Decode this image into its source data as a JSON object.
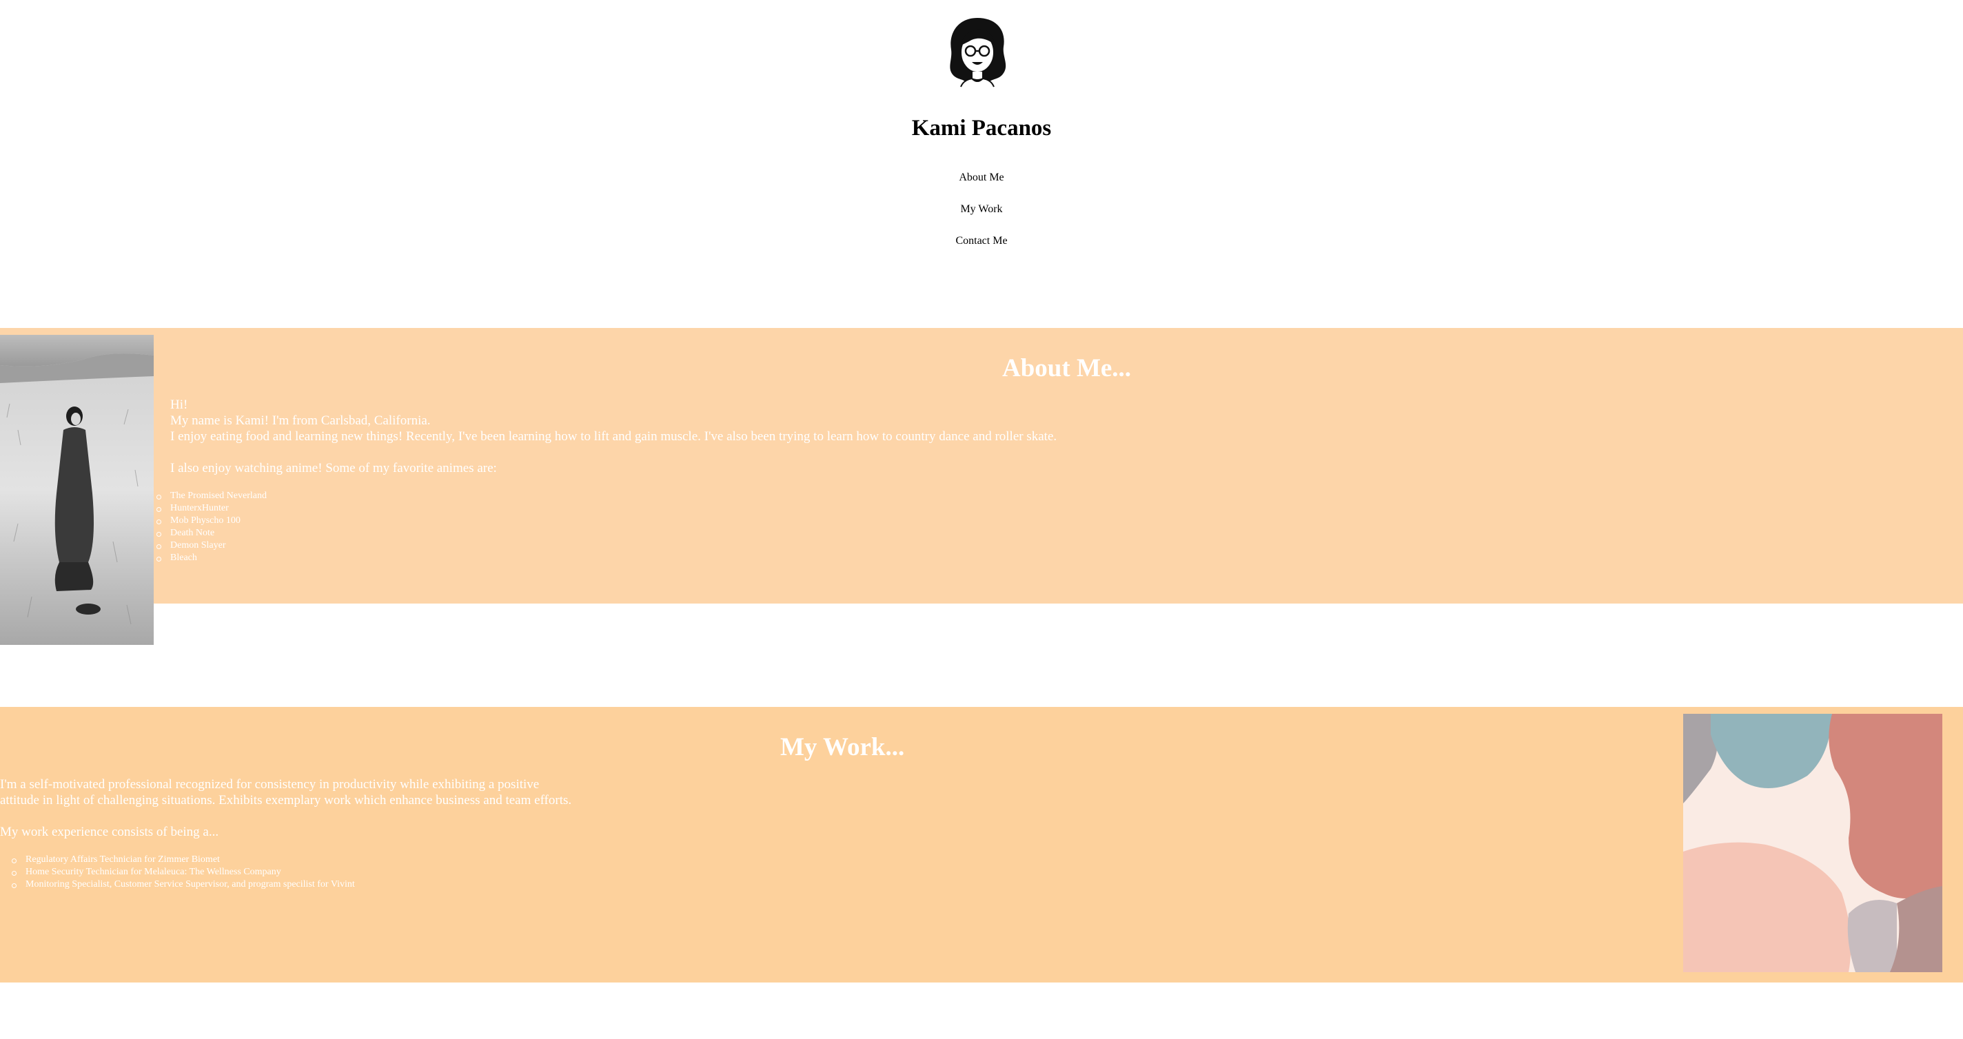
{
  "header": {
    "avatar_icon": "cartoon-woman-with-glasses-portrait",
    "title": "Kami Pacanos"
  },
  "nav": {
    "items": [
      "About Me",
      "My Work",
      "Contact Me"
    ]
  },
  "about": {
    "heading": "About Me...",
    "lines": [
      "Hi!",
      "My name is Kami! I'm from Carlsbad, California.",
      "I enjoy eating food and learning new things! Recently, I've been learning how to lift and gain muscle. I've also been trying to learn how to country dance and roller skate."
    ],
    "anime_intro": "I also enjoy watching anime! Some of my favorite animes are:",
    "animes": [
      "The Promised Neverland",
      "HunterxHunter",
      "Mob Physcho 100",
      "Death Note",
      "Demon Slayer",
      "Bleach"
    ],
    "photo": "black-and-white-photo-woman-in-field"
  },
  "work": {
    "heading": "My Work...",
    "paragraph_lines": [
      "I'm a self-motivated professional recognized for consistency in productivity while exhibiting a positive",
      "attitude in light of challenging situations. Exhibits exemplary work which enhance business and team efforts."
    ],
    "experience_intro": "My work experience consists of being a...",
    "jobs": [
      "Regulatory Affairs Technician for Zimmer Biomet",
      "Home Security Technician for Melaleuca: The Wellness Company",
      "Monitoring Specialist, Customer Service Supervisor, and program specilist for Vivint"
    ],
    "artwork": "abstract-pastel-shapes-artwork"
  },
  "colors": {
    "about_band": "#fdd5a9",
    "work_band": "#fdd19c",
    "text_on_band": "#ffffff"
  }
}
